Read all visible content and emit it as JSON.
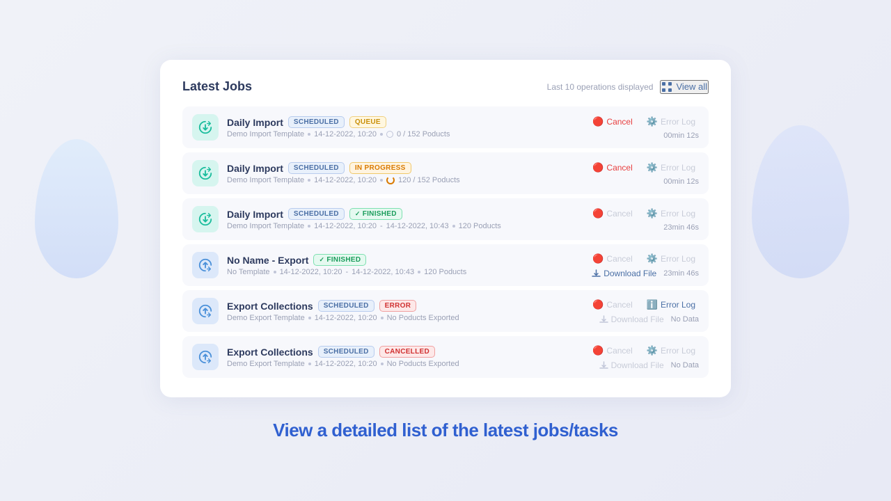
{
  "header": {
    "title": "Latest Jobs",
    "last_ops_label": "Last 10 operations displayed",
    "view_all_label": "View all"
  },
  "jobs": [
    {
      "id": "job1",
      "name": "Daily Import",
      "icon_type": "import",
      "badges": [
        {
          "label": "SCHEDULED",
          "type": "scheduled",
          "icon": "🗓"
        },
        {
          "label": "QUEUE",
          "type": "queue",
          "icon": "⬤"
        }
      ],
      "template": "Demo Import Template",
      "date": "14-12-2022, 10:20",
      "date_end": null,
      "progress_type": "circle",
      "progress_text": "0 / 152 Poducts",
      "cancel": {
        "label": "Cancel",
        "active": true
      },
      "error_log": {
        "label": "Error Log",
        "active": false
      },
      "download": null,
      "time": "00min 12s",
      "no_data": null
    },
    {
      "id": "job2",
      "name": "Daily Import",
      "icon_type": "import",
      "badges": [
        {
          "label": "SCHEDULED",
          "type": "scheduled",
          "icon": "🗓"
        },
        {
          "label": "IN PROGRESS",
          "type": "inprogress",
          "icon": "⬤"
        }
      ],
      "template": "Demo Import Template",
      "date": "14-12-2022, 10:20",
      "date_end": null,
      "progress_type": "spinner",
      "progress_text": "120 / 152 Poducts",
      "cancel": {
        "label": "Cancel",
        "active": true
      },
      "error_log": {
        "label": "Error Log",
        "active": false
      },
      "download": null,
      "time": "00min 12s",
      "no_data": null
    },
    {
      "id": "job3",
      "name": "Daily Import",
      "icon_type": "import",
      "badges": [
        {
          "label": "SCHEDULED",
          "type": "scheduled",
          "icon": "🗓"
        },
        {
          "label": "FINISHED",
          "type": "finished",
          "icon": "✓"
        }
      ],
      "template": "Demo Import Template",
      "date": "14-12-2022, 10:20",
      "date_end": "14-12-2022, 10:43",
      "progress_type": null,
      "progress_text": "120 Poducts",
      "cancel": {
        "label": "Cancel",
        "active": false
      },
      "error_log": {
        "label": "Error Log",
        "active": false
      },
      "download": null,
      "time": "23min 46s",
      "no_data": null
    },
    {
      "id": "job4",
      "name": "No Name - Export",
      "icon_type": "export",
      "badges": [
        {
          "label": "FINISHED",
          "type": "finished",
          "icon": "✓"
        }
      ],
      "template": "No Template",
      "date": "14-12-2022, 10:20",
      "date_end": "14-12-2022, 10:43",
      "progress_type": null,
      "progress_text": "120 Poducts",
      "cancel": {
        "label": "Cancel",
        "active": false
      },
      "error_log": {
        "label": "Error Log",
        "active": false
      },
      "download": {
        "label": "Download File",
        "active": true
      },
      "time": "23min 46s",
      "no_data": null
    },
    {
      "id": "job5",
      "name": "Export Collections",
      "icon_type": "export",
      "badges": [
        {
          "label": "SCHEDULED",
          "type": "scheduled",
          "icon": "🗓"
        },
        {
          "label": "ERROR",
          "type": "error",
          "icon": "⬤"
        }
      ],
      "template": "Demo Export Template",
      "date": "14-12-2022, 10:20",
      "date_end": null,
      "progress_type": null,
      "progress_text": "No Poducts Exported",
      "cancel": {
        "label": "Cancel",
        "active": false
      },
      "error_log": {
        "label": "Error Log",
        "active": true
      },
      "download": {
        "label": "Download File",
        "active": false
      },
      "time": null,
      "no_data": "No Data"
    },
    {
      "id": "job6",
      "name": "Export Collections",
      "icon_type": "export",
      "badges": [
        {
          "label": "SCHEDULED",
          "type": "scheduled",
          "icon": "🗓"
        },
        {
          "label": "CANCELLED",
          "type": "cancelled",
          "icon": "⬤"
        }
      ],
      "template": "Demo Export Template",
      "date": "14-12-2022, 10:20",
      "date_end": null,
      "progress_type": null,
      "progress_text": "No Poducts Exported",
      "cancel": {
        "label": "Cancel",
        "active": false
      },
      "error_log": {
        "label": "Error Log",
        "active": false
      },
      "download": {
        "label": "Download File",
        "active": false
      },
      "time": null,
      "no_data": "No Data"
    }
  ],
  "bottom_text": "View a detailed list of the latest jobs/tasks"
}
